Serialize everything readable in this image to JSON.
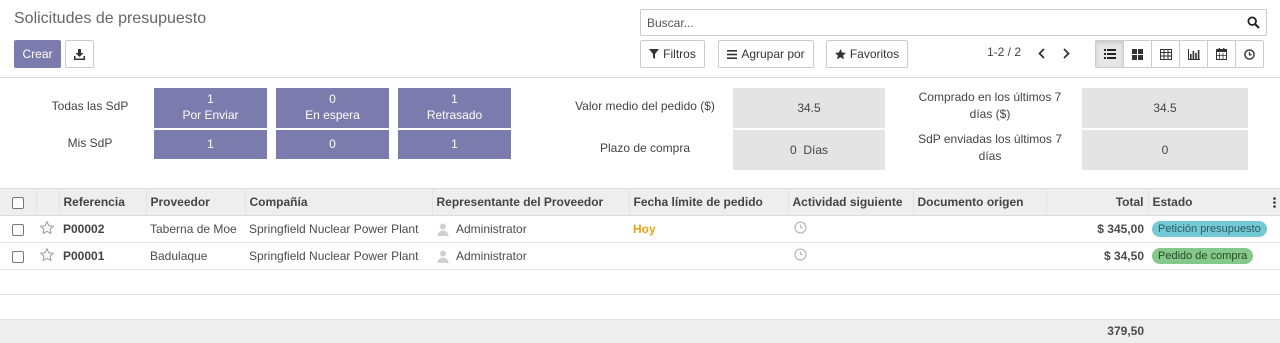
{
  "page": {
    "title": "Solicitudes de presupuesto"
  },
  "toolbar": {
    "create_label": "Crear",
    "download_icon": "download-icon"
  },
  "search": {
    "placeholder": "Buscar...",
    "icon": "search-icon"
  },
  "filters": {
    "filters_label": "Filtros",
    "groupby_label": "Agrupar por",
    "favorites_label": "Favoritos"
  },
  "pager": {
    "value": "1-2 / 2"
  },
  "views": [
    "list-view-icon",
    "kanban-view-icon",
    "pivot-view-icon",
    "graph-view-icon",
    "calendar-view-icon",
    "activity-view-icon"
  ],
  "dashboard": {
    "all_rfqs_label": "Todas las SdP",
    "my_rfqs_label": "Mis SdP",
    "all": [
      {
        "count": "1",
        "label": "Por Enviar"
      },
      {
        "count": "0",
        "label": "En espera"
      },
      {
        "count": "1",
        "label": "Retrasado"
      }
    ],
    "my": [
      "1",
      "0",
      "1"
    ],
    "avg_order_label": "Valor medio del pedido ($)",
    "avg_order_value": "34.5",
    "lead_time_label": "Plazo de compra",
    "lead_time_value": "0  Días",
    "purchased_label": "Comprado en los últimos 7 días ($)",
    "purchased_value": "34.5",
    "sent_label": "SdP enviadas los últimos 7 días",
    "sent_value": "0"
  },
  "table": {
    "columns": [
      "Referencia",
      "Proveedor",
      "Compañía",
      "Representante del Proveedor",
      "Fecha límite de pedido",
      "Actividad siguiente",
      "Documento origen",
      "Total",
      "Estado"
    ],
    "rows": [
      {
        "ref": "P00002",
        "vendor": "Taberna de Moe",
        "company": "Springfield Nuclear Power Plant",
        "rep": "Administrator",
        "deadline": "Hoy",
        "origin": "",
        "total": "$ 345,00",
        "status": "Petición presupuesto"
      },
      {
        "ref": "P00001",
        "vendor": "Badulaque",
        "company": "Springfield Nuclear Power Plant",
        "rep": "Administrator",
        "deadline": "",
        "origin": "",
        "total": "$ 34,50",
        "status": "Pedido de compra"
      }
    ],
    "sum_total": "379,50"
  },
  "colors": {
    "primary": "#7c7bad",
    "today": "#e9a115",
    "badge_info": "#73c9d5",
    "badge_success": "#86c78a"
  }
}
